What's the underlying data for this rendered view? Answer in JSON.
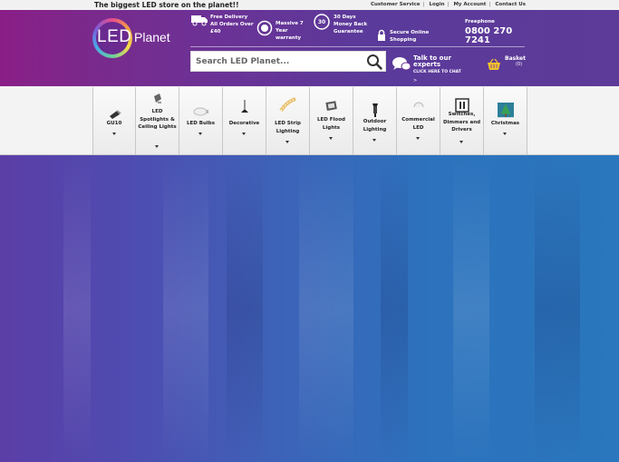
{
  "topbar": {
    "tagline": "The biggest LED store on the planet!!",
    "links": [
      "Customer Service",
      "Login",
      "My Account",
      "Contact Us"
    ]
  },
  "logo": {
    "part1": "LED",
    "part2": "Planet"
  },
  "usps": [
    {
      "icon": "delivery-truck-icon",
      "text": "Free Delivery All Orders Over £40"
    },
    {
      "icon": "warranty-badge-icon",
      "text": "Massive 7 Year warranty"
    },
    {
      "icon": "money-back-icon",
      "badge": "30",
      "text": "30 Days Money Back Guarantee"
    },
    {
      "icon": "padlock-icon",
      "text": "Secure Online Shopping"
    }
  ],
  "phone": {
    "label": "Freephone",
    "number": "0800 270 7241"
  },
  "search": {
    "placeholder": "Search LED Planet..."
  },
  "chat": {
    "title": "Talk to our experts",
    "cta": "CLICK HERE TO CHAT",
    "arrow": ">"
  },
  "basket": {
    "label": "Basket",
    "count": "(0)"
  },
  "nav": [
    {
      "label": "GU10",
      "icon": "gu10-bulb-icon"
    },
    {
      "label": "LED Spotlights & Ceiling Lights",
      "icon": "spotlight-icon"
    },
    {
      "label": "LED Bulbs",
      "icon": "bulb-icon"
    },
    {
      "label": "Decorative",
      "icon": "pendant-lamp-icon"
    },
    {
      "label": "LED Strip Lighting",
      "icon": "led-strip-icon"
    },
    {
      "label": "LED Flood Lights",
      "icon": "floodlight-icon"
    },
    {
      "label": "Outdoor Lighting",
      "icon": "lantern-icon"
    },
    {
      "label": "Commercial LED",
      "icon": "commercial-light-icon"
    },
    {
      "label": "Switches, Dimmers and Drivers",
      "icon": "switch-icon"
    },
    {
      "label": "Christmas",
      "icon": "christmas-tree-icon"
    }
  ],
  "colors": {
    "header": "#6b3296",
    "hero": "#3d63b8"
  }
}
